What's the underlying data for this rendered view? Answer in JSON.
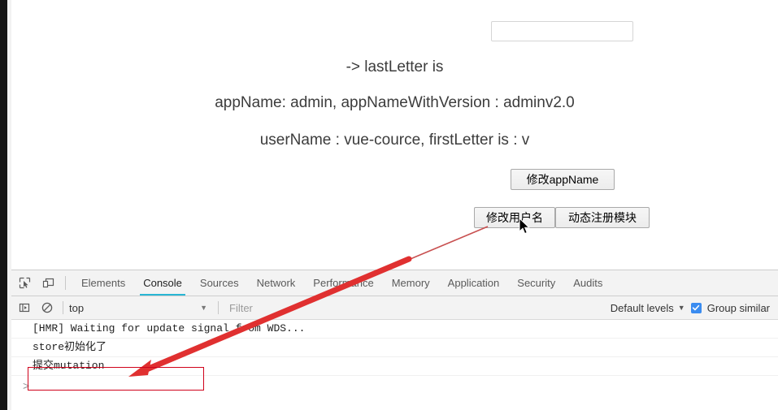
{
  "page": {
    "input": {
      "value": "",
      "placeholder": ""
    },
    "lines": [
      "-> lastLetter is",
      "appName: admin, appNameWithVersion : adminv2.0",
      "userName : vue-cource, firstLetter is : v"
    ],
    "buttons": {
      "change_appname": "修改appName",
      "change_username": "修改用户名",
      "dynamic_module": "动态注册模块"
    },
    "cursor_icon": "mouse-pointer-icon"
  },
  "devtools": {
    "toolbar_icons": [
      "inspect-element-icon",
      "device-toolbar-icon"
    ],
    "tabs": [
      {
        "label": "Elements",
        "active": false
      },
      {
        "label": "Console",
        "active": true
      },
      {
        "label": "Sources",
        "active": false
      },
      {
        "label": "Network",
        "active": false
      },
      {
        "label": "Performance",
        "active": false
      },
      {
        "label": "Memory",
        "active": false
      },
      {
        "label": "Application",
        "active": false
      },
      {
        "label": "Security",
        "active": false
      },
      {
        "label": "Audits",
        "active": false
      }
    ],
    "console_toolbar": {
      "sidebar_icon": "console-sidebar-toggle-icon",
      "clear_icon": "clear-console-icon",
      "context": "top",
      "context_caret": "▼",
      "filter_placeholder": "Filter",
      "filter_value": "",
      "levels_label": "Default levels",
      "levels_caret": "▼",
      "group_similar_label": "Group similar",
      "group_similar_checked": true,
      "checkbox_color": "#3b8cf0"
    },
    "messages": [
      "[HMR] Waiting for update signal from WDS...",
      "store初始化了",
      "提交mutation"
    ],
    "prompt": ">",
    "active_tab_underline_color": "#29b6d4"
  },
  "annotation": {
    "arrow_color": "#e03030",
    "box_color": "#d0021b",
    "highlighted_message": "提交mutation"
  }
}
